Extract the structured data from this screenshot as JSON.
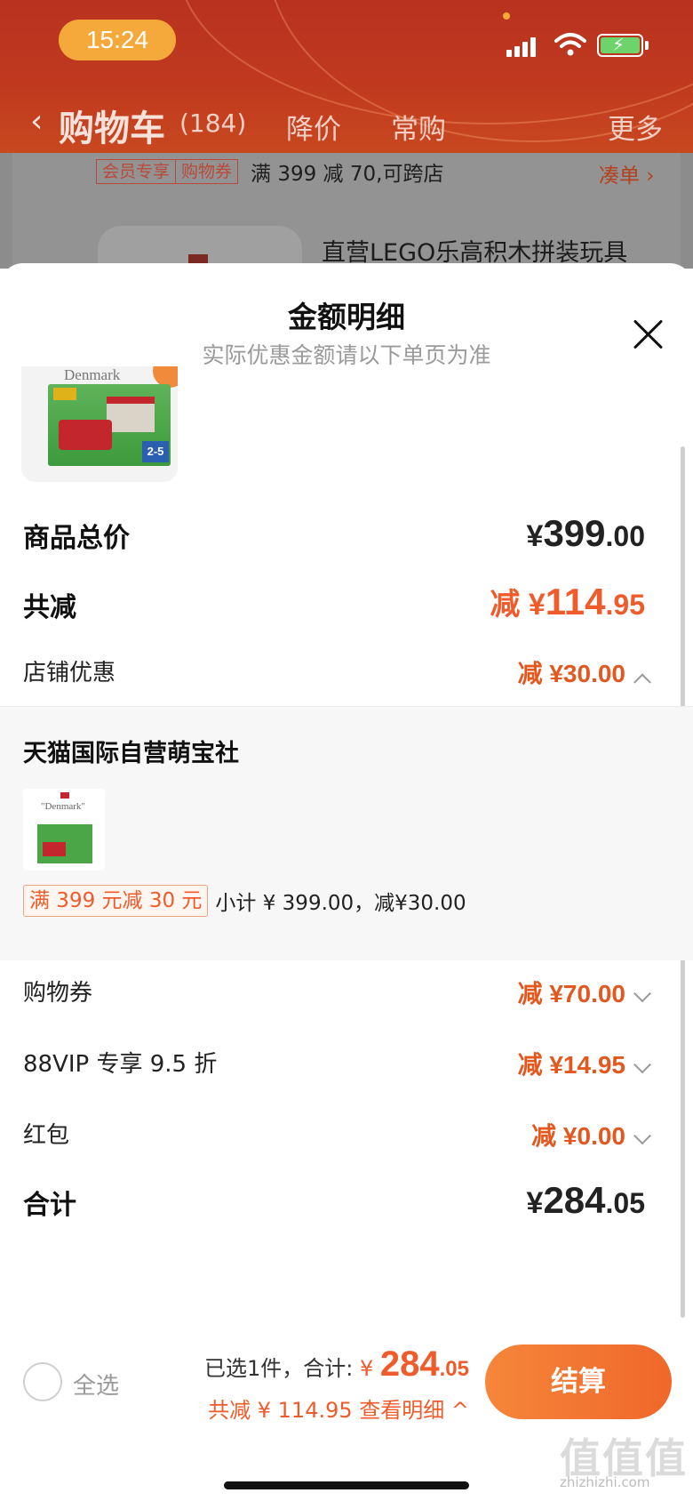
{
  "status_bar": {
    "time": "15:24"
  },
  "nav": {
    "back_glyph": "‹",
    "title": "购物车",
    "count": "(184)",
    "tabs": [
      "降价",
      "常购"
    ],
    "more": "更多"
  },
  "background_cart": {
    "coupon_tags": [
      "会员专享",
      "购物券"
    ],
    "coupon_text": "满 399 减 70,可跨店",
    "coupon_link": "凑单 ›",
    "product_title": "直营LEGO乐高积木拼装玩具"
  },
  "sheet": {
    "title": "金额明细",
    "subtitle": "实际优惠金额请以下单页为准",
    "product_image_text": "Denmark",
    "rows": {
      "goods_total": {
        "label": "商品总价",
        "currency": "¥",
        "int": "399",
        "dec": ".00"
      },
      "total_reduce": {
        "label": "共减",
        "prefix": "减 ¥",
        "int": "114",
        "dec": ".95"
      },
      "store_discount": {
        "label": "店铺优惠",
        "value": "减 ¥30.00"
      },
      "coupon": {
        "label": "购物券",
        "value": "减 ¥70.00"
      },
      "vip": {
        "label": "88VIP 专享 9.5 折",
        "value": "减 ¥14.95"
      },
      "red_packet": {
        "label": "红包",
        "value": "减 ¥0.00"
      },
      "grand_total": {
        "label": "合计",
        "currency": "¥",
        "int": "284",
        "dec": ".05"
      }
    },
    "shop": {
      "name": "天猫国际自营萌宝社",
      "thumb_text": "\"Denmark\"",
      "promo_tag": "满 399 元减 30 元",
      "promo_text": "小计 ¥ 399.00，减¥30.00"
    }
  },
  "footer": {
    "select_all": "全选",
    "selected_prefix": "已选1件，合计: ",
    "currency": "¥",
    "total_int": "284",
    "total_dec": ".05",
    "saved_text": "共减 ¥ 114.95  查看明细 ^",
    "checkout": "结算"
  },
  "watermark": {
    "text": "值值值",
    "sub": "zhizhizhi.com"
  },
  "colors": {
    "accent": "#ef5b2a",
    "header": "#c0391f",
    "checkout_start": "#f5863a",
    "checkout_end": "#f0672a"
  }
}
